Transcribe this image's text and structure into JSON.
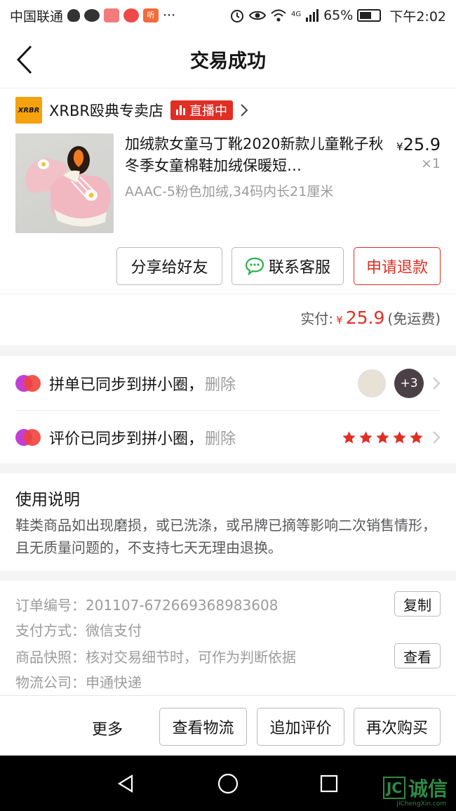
{
  "status_bar": {
    "carrier": "中国联通",
    "more": "···",
    "network": "4G",
    "battery": "65%",
    "time": "下午2:02"
  },
  "nav": {
    "title": "交易成功"
  },
  "shop": {
    "logo_text": "XRBR",
    "name": "XRBR殴典专卖店",
    "live_label": "直播中"
  },
  "product": {
    "title": "加绒款女童马丁靴2020新款儿童靴子秋冬季女童棉鞋加绒保暖短…",
    "currency": "¥",
    "price": "25.9",
    "qty": "×1",
    "spec": "AAAC-5粉色加绒,34码内长21厘米"
  },
  "actions": {
    "share": "分享给好友",
    "contact": "联系客服",
    "refund": "申请退款"
  },
  "payment": {
    "label": "实付:",
    "currency": "¥",
    "amount": "25.9",
    "note": "(免运费)"
  },
  "sync": [
    {
      "text": "拼单已同步到拼小圈，",
      "action": "删除",
      "more_count": "+3"
    },
    {
      "text": "评价已同步到拼小圈，",
      "action": "删除",
      "stars": 5
    }
  ],
  "usage": {
    "title": "使用说明",
    "text": "鞋类商品如出现磨损，或已洗涤，或吊牌已摘等影响二次销售情形，且无质量问题的，不支持七天无理由退换。"
  },
  "order_info": {
    "order_no_label": "订单编号：",
    "order_no": "201107-672669368983608",
    "copy_btn": "复制",
    "pay_method_label": "支付方式：",
    "pay_method": "微信支付",
    "snapshot_label": "商品快照：",
    "snapshot": "核对交易细节时，可作为判断依据",
    "view_btn": "查看",
    "logistics_label": "物流公司：",
    "logistics": "申通快递"
  },
  "bottom_bar": {
    "more": "更多",
    "track": "查看物流",
    "add_review": "追加评价",
    "buy_again": "再次购买"
  },
  "watermark": {
    "box": "JC",
    "text": "诚信",
    "sub": "JiChengXin.com"
  },
  "colors": {
    "accent": "#e02e24",
    "text": "#151516",
    "muted": "#9c9c9c",
    "band": "#f4f4f4"
  }
}
